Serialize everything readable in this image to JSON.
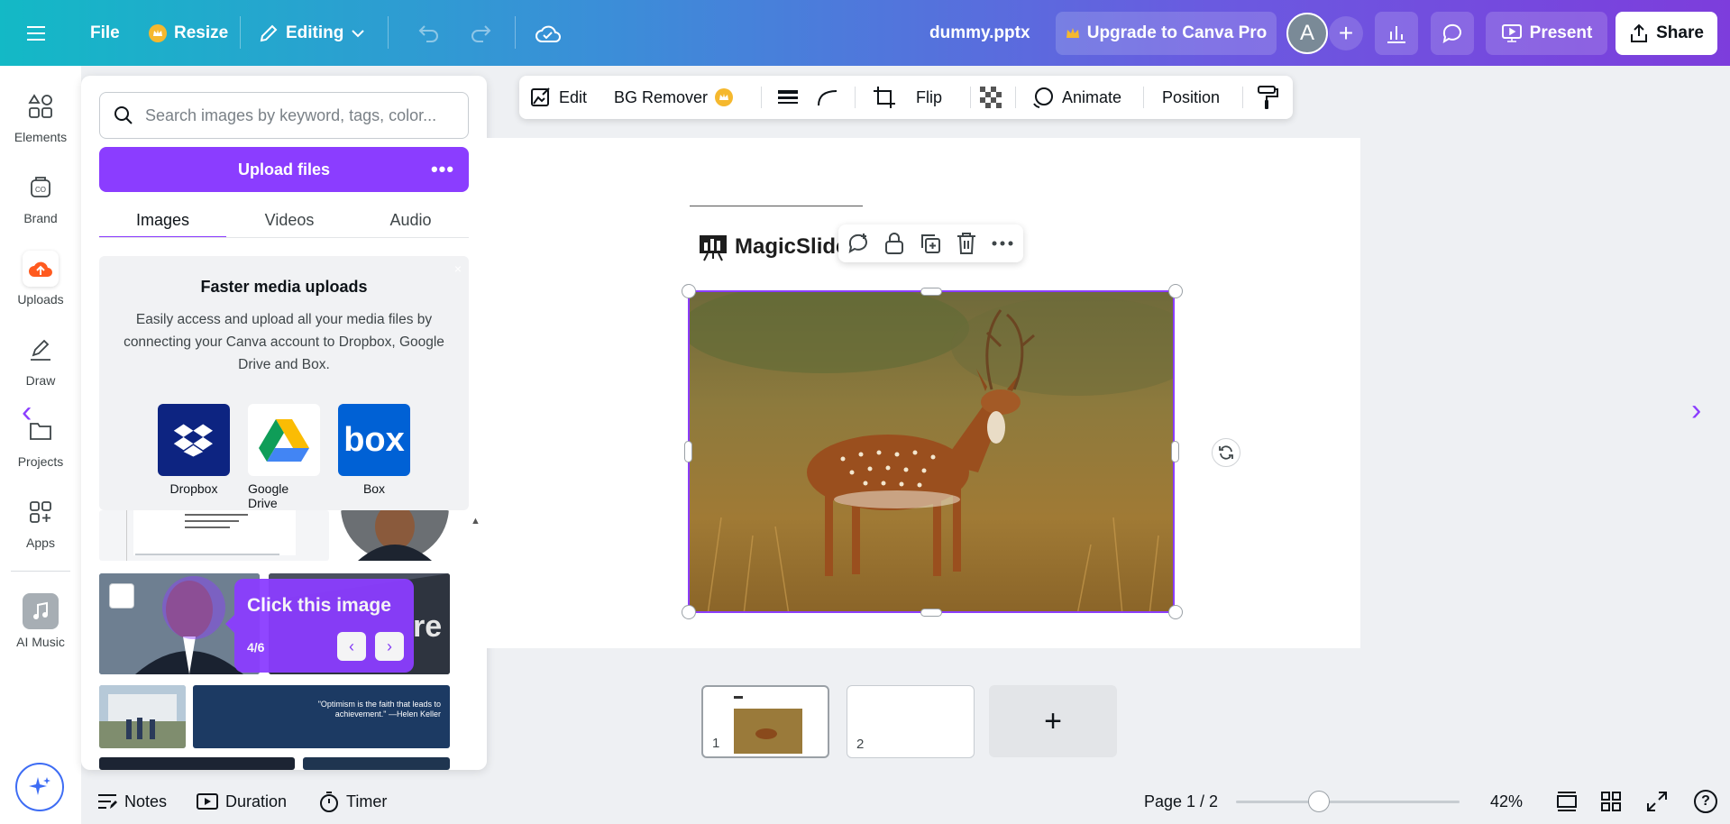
{
  "topbar": {
    "menu_icon": "hamburger-icon",
    "file_label": "File",
    "resize_label": "Resize",
    "editing_label": "Editing",
    "doc_title": "dummy.pptx",
    "upgrade_label": "Upgrade to Canva Pro",
    "avatar_initial": "A",
    "add_label": "+",
    "present_label": "Present",
    "share_label": "Share"
  },
  "rail": {
    "items": [
      {
        "label": "Elements",
        "icon": "elements-icon"
      },
      {
        "label": "Brand",
        "icon": "brand-icon"
      },
      {
        "label": "Uploads",
        "icon": "uploads-icon"
      },
      {
        "label": "Draw",
        "icon": "draw-icon"
      },
      {
        "label": "Projects",
        "icon": "projects-icon"
      },
      {
        "label": "Apps",
        "icon": "apps-icon"
      },
      {
        "label": "AI Music",
        "icon": "music-icon"
      }
    ]
  },
  "panel": {
    "search_placeholder": "Search images by keyword, tags, color...",
    "upload_label": "Upload files",
    "more_label": "•••",
    "tabs": [
      "Images",
      "Videos",
      "Audio"
    ],
    "promo": {
      "close": "×",
      "title": "Faster media uploads",
      "description": "Easily access and upload all your media files by connecting your Canva account to Dropbox, Google Drive and Box.",
      "providers": [
        "Dropbox",
        "Google Drive",
        "Box"
      ],
      "box_logo_text": "box"
    },
    "thumb_quote": "\"Optimism is the faith that leads to achievement.\" —Helen Keller",
    "tooltip": {
      "title": "Click this image",
      "step": "4/6",
      "prev": "‹",
      "next": "›"
    }
  },
  "context_toolbar": {
    "edit_label": "Edit",
    "bg_remover_label": "BG Remover",
    "flip_label": "Flip",
    "animate_label": "Animate",
    "position_label": "Position"
  },
  "canvas": {
    "logo_text": "MagicSlide"
  },
  "pages": {
    "thumbnails": [
      "1",
      "2"
    ],
    "add_label": "+"
  },
  "bottombar": {
    "notes_label": "Notes",
    "duration_label": "Duration",
    "timer_label": "Timer",
    "page_indicator": "Page 1 / 2",
    "zoom_level": "42%",
    "zoom_fraction": 0.37,
    "help_label": "?"
  },
  "colors": {
    "accent": "#8b3dff",
    "topbar_start": "#13b9c6",
    "topbar_end": "#7d3ddc",
    "crown": "#f5b82e"
  }
}
